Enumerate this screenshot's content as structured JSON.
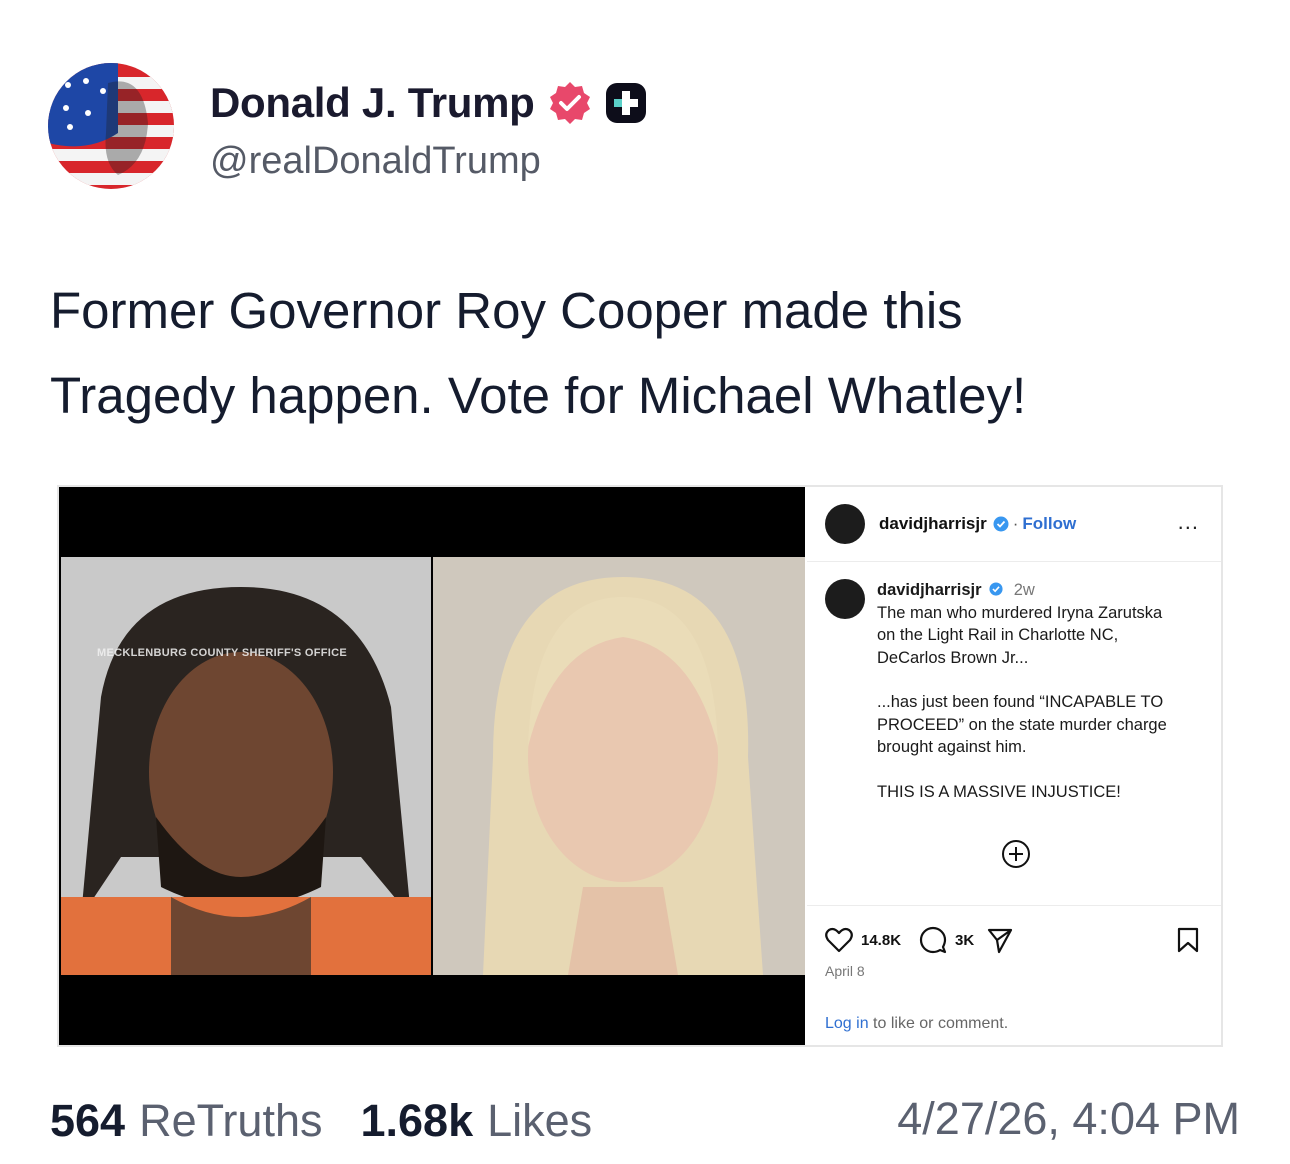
{
  "post": {
    "display_name": "Donald J. Trump",
    "handle": "@realDonaldTrump",
    "text_line1": "Former Governor Roy Cooper made this",
    "text_line2": "Tragedy happen. Vote for Michael Whatley!"
  },
  "embed": {
    "watermark": "MECKLENBURG COUNTY SHERIFF'S OFFICE",
    "instagram": {
      "username": "davidjharrisjr",
      "follow_label": "Follow",
      "more_label": "...",
      "caption_time": "2w",
      "caption_p1_l1": "The man who murdered Iryna Zarutska",
      "caption_p1_l2": "on the Light Rail in Charlotte NC,",
      "caption_p1_l3": "DeCarlos Brown Jr...",
      "caption_p2_l1": "...has just been found “INCAPABLE TO",
      "caption_p2_l2": "PROCEED” on the state murder charge",
      "caption_p2_l3": "brought against him.",
      "caption_p3": "THIS IS A MASSIVE INJUSTICE!",
      "likes": "14.8K",
      "comments": "3K",
      "date": "April 8",
      "login_link": "Log in",
      "login_rest": " to like or comment."
    }
  },
  "stats": {
    "retruths_count": "564",
    "retruths_label": "ReTruths",
    "likes_count": "1.68k",
    "likes_label": "Likes",
    "timestamp": "4/27/26, 4:04 PM"
  },
  "colors": {
    "verified_badge": "#e8486b",
    "link_blue": "#2f6fd1"
  }
}
